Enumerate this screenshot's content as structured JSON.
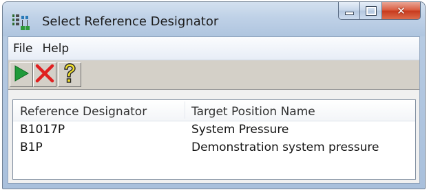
{
  "window": {
    "title": "Select Reference Designator",
    "icon": "reference-tree-icon",
    "caption_buttons": [
      "minimize-icon",
      "maximize-icon",
      "close-icon"
    ],
    "close_glyph": "✕"
  },
  "menu": {
    "file_label": "File",
    "help_label": "Help"
  },
  "toolbar": {
    "buttons": [
      {
        "icon": "play-icon",
        "color": "#1f9a3a"
      },
      {
        "icon": "cancel-x-icon",
        "color": "#e02020"
      },
      {
        "icon": "help-question-icon",
        "color": "#f2e030"
      }
    ]
  },
  "list": {
    "columns": [
      "Reference Designator",
      "Target Position Name"
    ],
    "rows": [
      [
        "B1017P",
        "System Pressure"
      ],
      [
        "B1P",
        "Demonstration system pressure"
      ]
    ]
  },
  "colors": {
    "titlebar": "#bfd1e7",
    "close_button": "#d9583b",
    "toolbar_bg": "#d4d0c8"
  }
}
